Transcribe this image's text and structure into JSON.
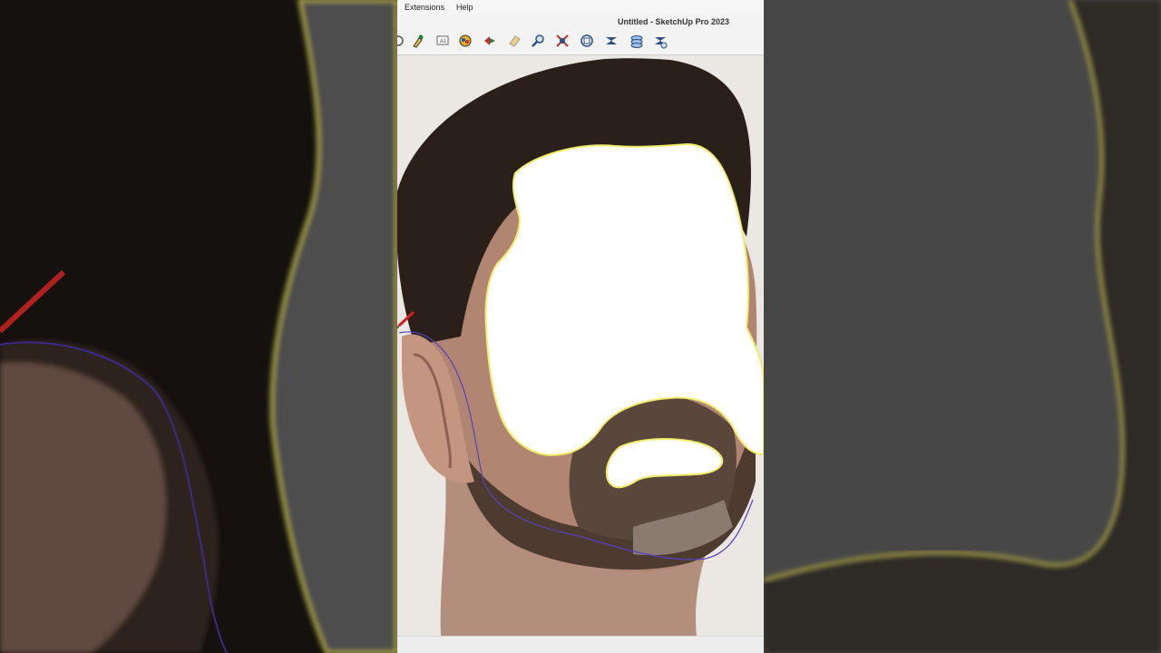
{
  "menu": {
    "items": [
      {
        "label": "Extensions"
      },
      {
        "label": "Help"
      }
    ]
  },
  "window": {
    "title": "Untitled - SketchUp Pro 2023"
  },
  "toolbar": {
    "tools": [
      {
        "icon": "orbit-icon"
      },
      {
        "icon": "pan-icon"
      },
      {
        "icon": "text-icon"
      },
      {
        "icon": "paint-bucket-icon"
      },
      {
        "icon": "follow-me-icon"
      },
      {
        "icon": "eraser-icon"
      },
      {
        "icon": "zoom-icon"
      },
      {
        "icon": "zoom-extents-icon"
      },
      {
        "icon": "zoom-window-icon"
      },
      {
        "icon": "sandbox-icon"
      },
      {
        "icon": "layers-icon"
      },
      {
        "icon": "styles-icon"
      }
    ]
  },
  "colors": {
    "accent": "#1a5fb4",
    "tool_stroke": "#2a4f80",
    "line_tool_red": "#d62020",
    "drawn_curve": "#5a3fbf"
  }
}
